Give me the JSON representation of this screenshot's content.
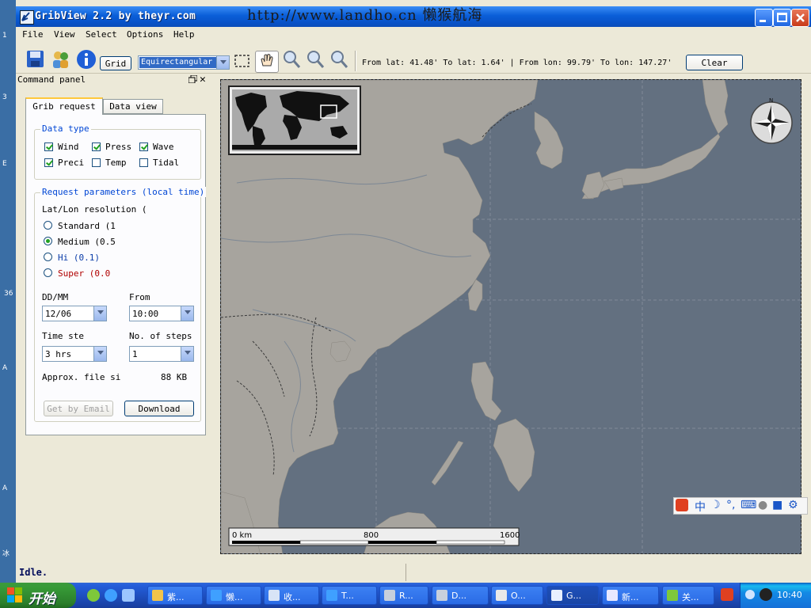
{
  "desktop": {
    "edge_labels": [
      "1",
      "3",
      "E",
      "36",
      "A",
      "A",
      "冰"
    ]
  },
  "window": {
    "title": "GribView 2.2 by theyr.com",
    "watermark": "http://www.landho.cn 懒猴航海"
  },
  "menu": [
    "File",
    "View",
    "Select",
    "Options",
    "Help"
  ],
  "toolbar": {
    "grid_label": "Grid",
    "projection": "Equirectangular",
    "coords": "From lat: 41.48'  To lat: 1.64'  |  From lon: 99.79'  To lon: 147.27'",
    "clear_label": "Clear"
  },
  "panel": {
    "title": "Command panel",
    "tabs": [
      "Grib request",
      "Data view"
    ],
    "data_type": {
      "title": "Data type",
      "items": [
        {
          "label": "Wind",
          "checked": true
        },
        {
          "label": "Press",
          "checked": true
        },
        {
          "label": "Wave",
          "checked": true
        },
        {
          "label": "Preci",
          "checked": true
        },
        {
          "label": "Temp",
          "checked": false
        },
        {
          "label": "Tidal",
          "checked": false
        }
      ]
    },
    "request": {
      "title": "Request parameters (local time)",
      "resolution_label": "Lat/Lon resolution (",
      "resolutions": [
        {
          "label": "Standard (1",
          "selected": false,
          "color": "#000000"
        },
        {
          "label": "Medium (0.5",
          "selected": true,
          "color": "#000000"
        },
        {
          "label": "Hi (0.1)",
          "selected": false,
          "color": "#0a3ca8"
        },
        {
          "label": "Super (0.0",
          "selected": false,
          "color": "#b00000"
        }
      ],
      "date_label": "DD/MM",
      "date_value": "12/06",
      "from_label": "From",
      "from_value": "10:00",
      "step_label": "Time ste",
      "step_value": "3 hrs",
      "nsteps_label": "No. of steps",
      "nsteps_value": "1",
      "filesize_label": "Approx. file si",
      "filesize_value": "88 KB",
      "email_label": "Get by Email",
      "download_label": "Download"
    }
  },
  "map": {
    "compass_n": "N",
    "scale_labels": [
      "0 km",
      "800",
      "1600"
    ]
  },
  "status": "Idle.",
  "ime_labels": [
    "中"
  ],
  "taskbar": {
    "start": "开始",
    "tasks": [
      "紫...",
      "懒...",
      "收...",
      "T...",
      "R...",
      "D...",
      "O...",
      "G...",
      "新...",
      "关..."
    ],
    "clock": "10:40"
  }
}
